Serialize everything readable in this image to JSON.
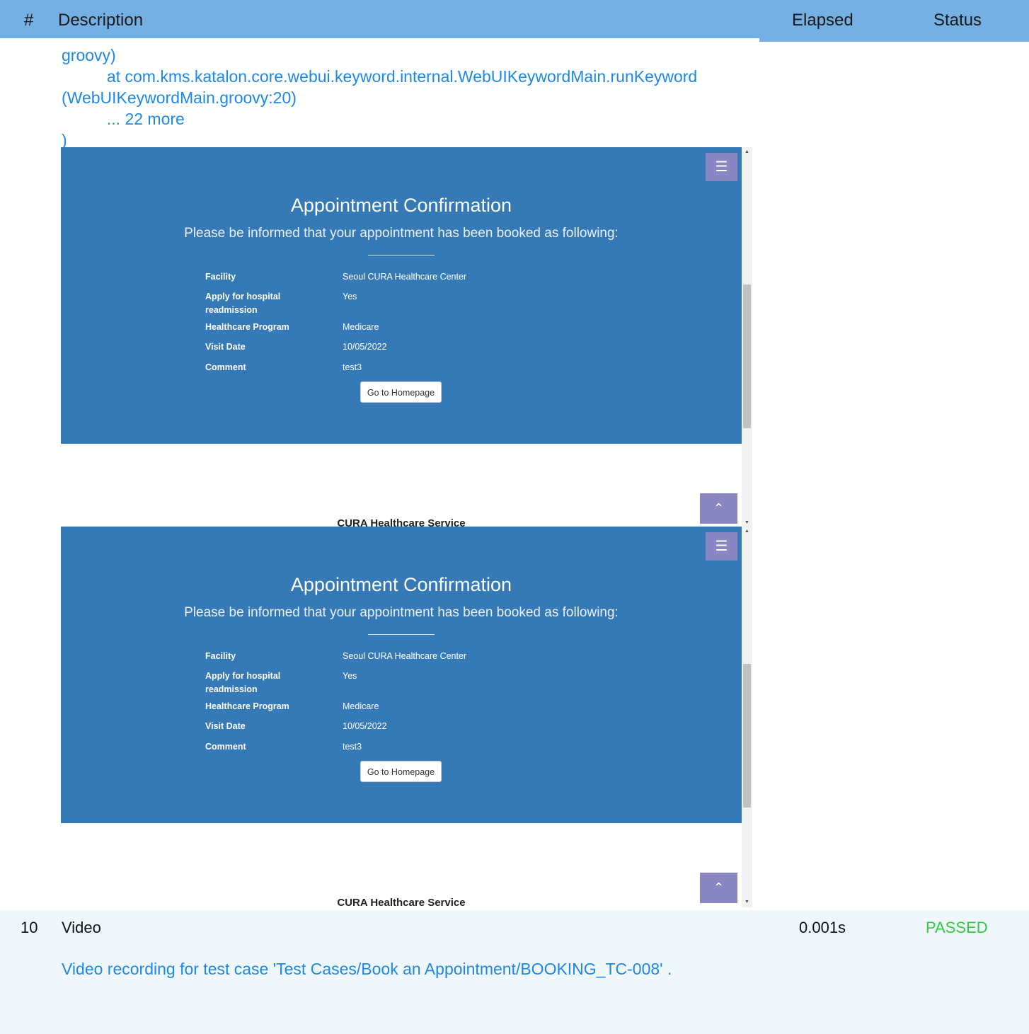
{
  "header": {
    "num": "#",
    "description": "Description",
    "elapsed": "Elapsed",
    "status": "Status"
  },
  "log_lines": [
    "groovy)",
    "          at com.kms.katalon.core.webui.keyword.internal.WebUIKeywordMain.runKeyword",
    "(WebUIKeywordMain.groovy:20)",
    "          ... 22 more",
    ")"
  ],
  "screenshot": {
    "title": "Appointment Confirmation",
    "subtitle": "Please be informed that your appointment has been booked as following:",
    "fields": [
      {
        "label": "Facility",
        "value": "Seoul CURA Healthcare Center"
      },
      {
        "label": "Apply for hospital readmission",
        "value": "Yes"
      },
      {
        "label": "Healthcare Program",
        "value": "Medicare"
      },
      {
        "label": "Visit Date",
        "value": "10/05/2022"
      },
      {
        "label": "Comment",
        "value": "test3"
      }
    ],
    "home_button": "Go to Homepage",
    "footer": "CURA Healthcare Service",
    "menu_icon": "☰",
    "top_icon": "⌃",
    "scroll_up": "▲",
    "scroll_down": "▼"
  },
  "row10": {
    "num": "10",
    "description": "Video",
    "elapsed": "0.001s",
    "status": "PASSED",
    "message": "Video recording for test case 'Test Cases/Book an Appointment/BOOKING_TC-008' ."
  }
}
